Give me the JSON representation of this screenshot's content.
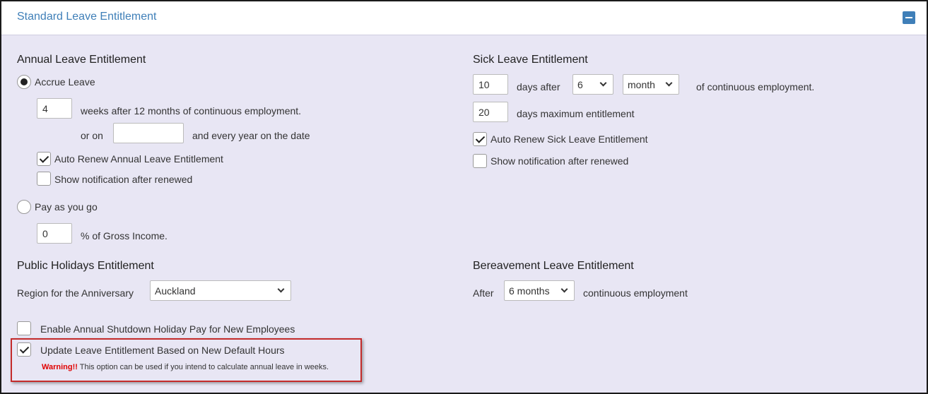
{
  "header": {
    "title": "Standard Leave Entitlement"
  },
  "annual": {
    "title": "Annual Leave Entitlement",
    "accrue_label": "Accrue Leave",
    "weeks_value": "4",
    "weeks_text": "weeks after 12 months of continuous employment.",
    "or_on": "or on",
    "date_value": "",
    "every_year": "and every year on the date",
    "auto_renew": "Auto Renew Annual Leave Entitlement",
    "show_notification": "Show notification after renewed",
    "payg_label": "Pay as you go",
    "gross_value": "0",
    "gross_text": "% of Gross Income."
  },
  "sick": {
    "title": "Sick Leave Entitlement",
    "days_value": "10",
    "days_after": "days after",
    "period_value": "6",
    "unit_value": "month",
    "continuous": "of continuous employment.",
    "max_value": "20",
    "max_text": "days maximum entitlement",
    "auto_renew": "Auto Renew Sick Leave Entitlement",
    "show_notification": "Show notification after renewed"
  },
  "public": {
    "title": "Public Holidays Entitlement",
    "region_label": "Region for the Anniversary",
    "region_value": "Auckland"
  },
  "bereavement": {
    "title": "Bereavement Leave Entitlement",
    "after": "After",
    "period_value": "6 months",
    "continuous": "continuous employment"
  },
  "options": {
    "shutdown": "Enable Annual Shutdown Holiday Pay for New Employees",
    "update_hours": "Update Leave Entitlement Based on New Default Hours",
    "warning_label": "Warning!!",
    "warning_text": " This option can be used if you intend to calculate annual leave in weeks."
  }
}
